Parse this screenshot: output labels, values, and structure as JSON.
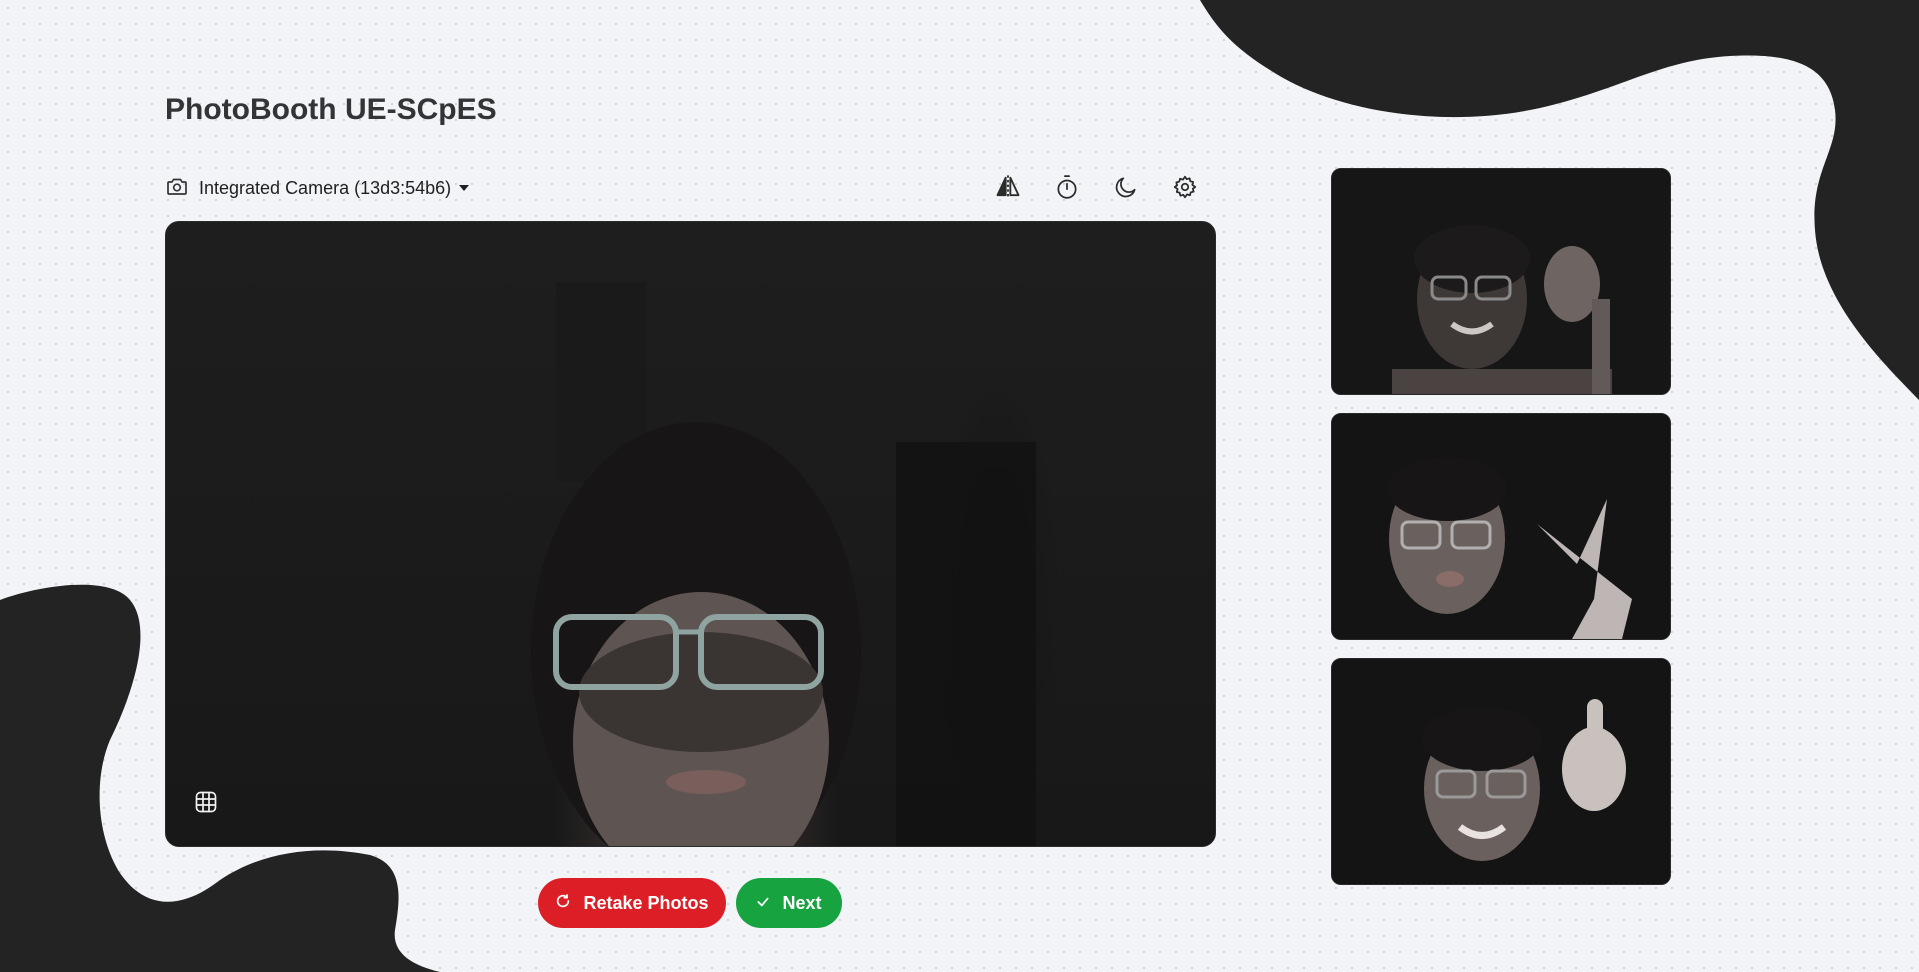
{
  "app": {
    "title": "PhotoBooth UE-SCpES"
  },
  "camera": {
    "selected": "Integrated Camera (13d3:54b6)"
  },
  "toolbar": {
    "mirror_icon": "mirror-flip-icon",
    "timer_icon": "timer-icon",
    "night_icon": "moon-icon",
    "settings_icon": "gear-icon"
  },
  "viewer": {
    "grid_icon": "grid-icon"
  },
  "actions": {
    "retake_label": "Retake Photos",
    "retake_icon": "refresh-icon",
    "next_label": "Next",
    "next_icon": "check-icon"
  },
  "captures": [
    {
      "pose": "thumbs-up"
    },
    {
      "pose": "peace-sign"
    },
    {
      "pose": "thumbs-up"
    }
  ],
  "colors": {
    "retake": "#dc1f26",
    "next": "#16a340",
    "blob": "#232323",
    "background": "#f3f4f8"
  }
}
